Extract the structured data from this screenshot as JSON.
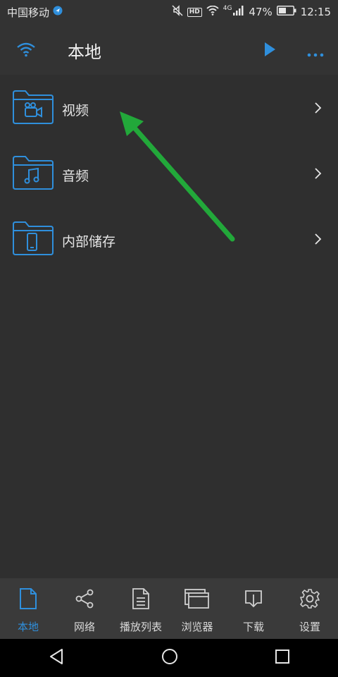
{
  "status_bar": {
    "carrier": "中国移动",
    "hd": "HD",
    "network": "4G",
    "battery": "47%",
    "time": "12:15"
  },
  "app_bar": {
    "title": "本地"
  },
  "list": {
    "items": [
      {
        "label": "视频",
        "icon": "video-camera-icon"
      },
      {
        "label": "音频",
        "icon": "music-note-icon"
      },
      {
        "label": "内部储存",
        "icon": "phone-icon"
      }
    ]
  },
  "bottom_nav": {
    "items": [
      {
        "label": "本地",
        "icon": "document-icon",
        "active": true
      },
      {
        "label": "网络",
        "icon": "share-icon",
        "active": false
      },
      {
        "label": "播放列表",
        "icon": "playlist-icon",
        "active": false
      },
      {
        "label": "浏览器",
        "icon": "browser-icon",
        "active": false
      },
      {
        "label": "下载",
        "icon": "download-icon",
        "active": false
      },
      {
        "label": "设置",
        "icon": "gear-icon",
        "active": false
      }
    ]
  },
  "colors": {
    "accent": "#2f8fdc",
    "background": "#2f2f2f",
    "annotation_arrow": "#22a83a"
  }
}
